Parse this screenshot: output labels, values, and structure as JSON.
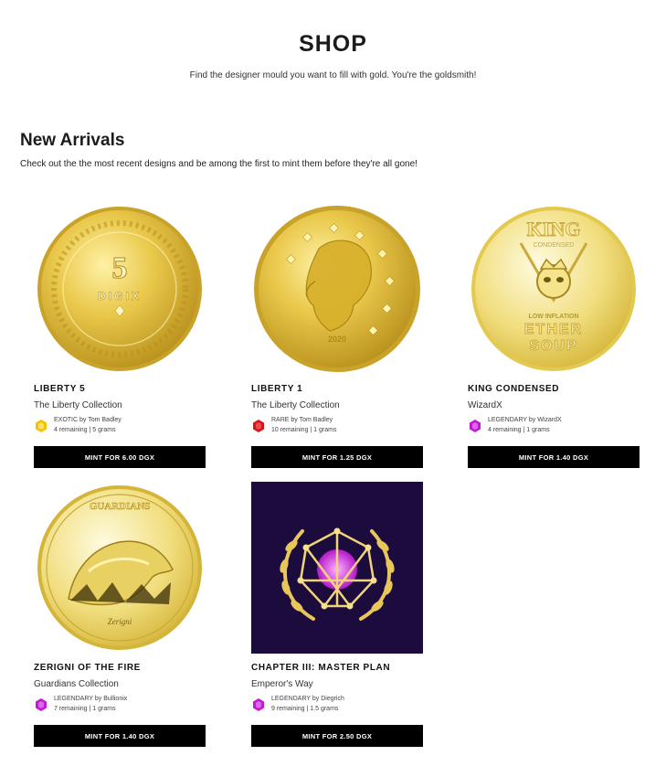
{
  "header": {
    "title": "SHOP",
    "subtitle": "Find the designer mould you want to fill with gold. You're the goldsmith!"
  },
  "section": {
    "title": "New Arrivals",
    "description": "Check out the the most recent designs and be among the first to mint them before they're all gone!"
  },
  "colors": {
    "exotic": "#f2c200",
    "rare": "#d7141c",
    "legendary": "#c21ad1",
    "button": "#000000",
    "gold": "#d8b12c",
    "chapter_bg": "#1c0b3d"
  },
  "items": [
    {
      "name": "LIBERTY 5",
      "collection": "The Liberty Collection",
      "rarity": "EXOTIC by Tom Badley",
      "rarity_icon": "hexagon-yellow-icon",
      "meta": "4 remaining | 5 grams",
      "button": "MINT FOR 6.00 DGX",
      "coin_number": "5",
      "coin_text": "DIGIX"
    },
    {
      "name": "LIBERTY 1",
      "collection": "The Liberty Collection",
      "rarity": "RARE by Tom Badley",
      "rarity_icon": "hexagon-red-icon",
      "meta": "10 remaining | 1 grams",
      "button": "MINT FOR 1.25 DGX",
      "coin_text": "2020"
    },
    {
      "name": "KING CONDENSED",
      "collection": "WizardX",
      "rarity": "LEGENDARY by WizardX",
      "rarity_icon": "hexagon-purple-icon",
      "meta": "4 remaining | 1 grams",
      "button": "MINT FOR 1.40 DGX",
      "coin_top": "KING",
      "coin_sub": "CONDENSED",
      "coin_line": "LOW INFLATION",
      "coin_big1": "ETHER",
      "coin_big2": "SOUP"
    },
    {
      "name": "ZERIGNI OF THE FIRE",
      "collection": "Guardians Collection",
      "rarity": "LEGENDARY by Bullionix",
      "rarity_icon": "hexagon-purple-icon",
      "meta": "7 remaining | 1 grams",
      "button": "MINT FOR 1.40 DGX",
      "coin_top": "GUARDIANS",
      "coin_bottom": "Zerigni"
    },
    {
      "name": "CHAPTER III: MASTER PLAN",
      "collection": "Emperor's Way",
      "rarity": "LEGENDARY by Diegrich",
      "rarity_icon": "hexagon-purple-icon",
      "meta": "9 remaining | 1.5 grams",
      "button": "MINT FOR 2.50 DGX"
    }
  ]
}
